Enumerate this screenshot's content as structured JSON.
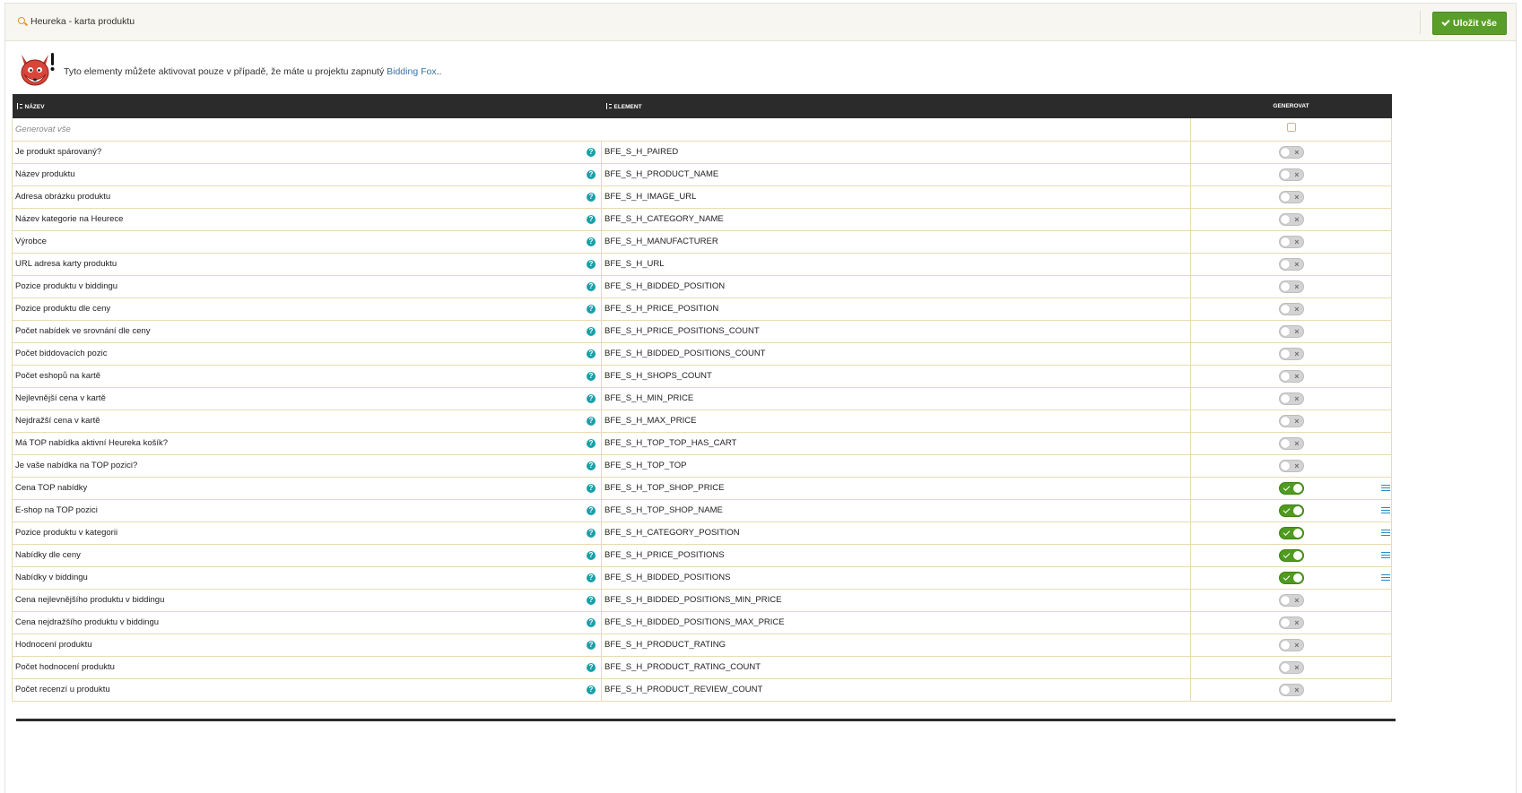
{
  "header": {
    "title": "Heureka - karta produktu",
    "save_label": "Uložit vše"
  },
  "notice": {
    "text": "Tyto elementy můžete aktivovat pouze v případě, že máte u projektu zapnutý",
    "link": "Bidding Fox",
    "suffix": ".."
  },
  "table": {
    "columns": [
      "NÁZEV",
      "ELEMENT",
      "GENEROVAT"
    ],
    "generate_all_label": "Generovat vše",
    "rows": [
      {
        "name": "Je produkt spárovaný?",
        "element": "BFE_S_H_PAIRED",
        "enabled": false
      },
      {
        "name": "Název produktu",
        "element": "BFE_S_H_PRODUCT_NAME",
        "enabled": false
      },
      {
        "name": "Adresa obrázku produktu",
        "element": "BFE_S_H_IMAGE_URL",
        "enabled": false
      },
      {
        "name": "Název kategorie na Heurece",
        "element": "BFE_S_H_CATEGORY_NAME",
        "enabled": false
      },
      {
        "name": "Výrobce",
        "element": "BFE_S_H_MANUFACTURER",
        "enabled": false
      },
      {
        "name": "URL adresa karty produktu",
        "element": "BFE_S_H_URL",
        "enabled": false
      },
      {
        "name": "Pozice produktu v biddingu",
        "element": "BFE_S_H_BIDDED_POSITION",
        "enabled": false
      },
      {
        "name": "Pozice produktu dle ceny",
        "element": "BFE_S_H_PRICE_POSITION",
        "enabled": false
      },
      {
        "name": "Počet nabídek ve srovnání dle ceny",
        "element": "BFE_S_H_PRICE_POSITIONS_COUNT",
        "enabled": false
      },
      {
        "name": "Počet biddovacích pozic",
        "element": "BFE_S_H_BIDDED_POSITIONS_COUNT",
        "enabled": false
      },
      {
        "name": "Počet eshopů na kartě",
        "element": "BFE_S_H_SHOPS_COUNT",
        "enabled": false
      },
      {
        "name": "Nejlevnější cena v kartě",
        "element": "BFE_S_H_MIN_PRICE",
        "enabled": false
      },
      {
        "name": "Nejdražší cena v kartě",
        "element": "BFE_S_H_MAX_PRICE",
        "enabled": false
      },
      {
        "name": "Má TOP nabídka aktivní Heureka košík?",
        "element": "BFE_S_H_TOP_TOP_HAS_CART",
        "enabled": false
      },
      {
        "name": "Je vaše nabídka na TOP pozici?",
        "element": "BFE_S_H_TOP_TOP",
        "enabled": false
      },
      {
        "name": "Cena TOP nabídky",
        "element": "BFE_S_H_TOP_SHOP_PRICE",
        "enabled": true
      },
      {
        "name": "E-shop na TOP pozici",
        "element": "BFE_S_H_TOP_SHOP_NAME",
        "enabled": true
      },
      {
        "name": "Pozice produktu v kategorii",
        "element": "BFE_S_H_CATEGORY_POSITION",
        "enabled": true
      },
      {
        "name": "Nabídky dle ceny",
        "element": "BFE_S_H_PRICE_POSITIONS",
        "enabled": true
      },
      {
        "name": "Nabídky v biddingu",
        "element": "BFE_S_H_BIDDED_POSITIONS",
        "enabled": true
      },
      {
        "name": "Cena nejlevnějšího produktu v biddingu",
        "element": "BFE_S_H_BIDDED_POSITIONS_MIN_PRICE",
        "enabled": false
      },
      {
        "name": "Cena nejdražšího produktu v biddingu",
        "element": "BFE_S_H_BIDDED_POSITIONS_MAX_PRICE",
        "enabled": false
      },
      {
        "name": "Hodnocení produktu",
        "element": "BFE_S_H_PRODUCT_RATING",
        "enabled": false
      },
      {
        "name": "Počet hodnocení produktu",
        "element": "BFE_S_H_PRODUCT_RATING_COUNT",
        "enabled": false
      },
      {
        "name": "Počet recenzí u produktu",
        "element": "BFE_S_H_PRODUCT_REVIEW_COUNT",
        "enabled": false
      }
    ]
  },
  "icons": {
    "title": "search-icon",
    "save": "check-icon",
    "mascot": "fox-logo",
    "help": "help-icon",
    "list": "list-icon",
    "sort": "sort-icon"
  },
  "colors": {
    "accent_green": "#5a9e2a",
    "header_dark": "#2b2b2b",
    "help_teal": "#18a0a8",
    "link_blue": "#3a72a8",
    "row_border": "#e8dbb0"
  }
}
